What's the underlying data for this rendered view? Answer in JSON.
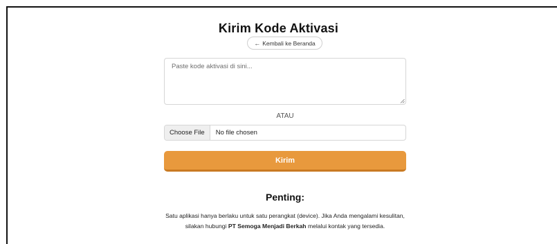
{
  "page": {
    "title": "Kirim Kode Aktivasi",
    "back_button": {
      "arrow": "←",
      "label": "Kembali ke Beranda"
    },
    "code_input": {
      "placeholder": "Paste kode aktivasi di sini...",
      "value": ""
    },
    "or_label": "ATAU",
    "file_input": {
      "button_label": "Choose File",
      "status": "No file chosen"
    },
    "submit_label": "Kirim",
    "important": {
      "title": "Penting:",
      "line1": "Satu aplikasi hanya berlaku untuk satu perangkat (device). Jika Anda mengalami kesulitan,",
      "line2_prefix": "silakan hubungi ",
      "line2_company": "PT Semoga Menjadi Berkah",
      "line2_suffix": " melalui kontak yang tersedia."
    }
  },
  "colors": {
    "accent": "#e8993d",
    "accent_dark": "#c97a22",
    "border": "#d6d6d6"
  },
  "icons": {
    "back": "left-arrow-icon",
    "resize": "resize-grip-icon"
  }
}
